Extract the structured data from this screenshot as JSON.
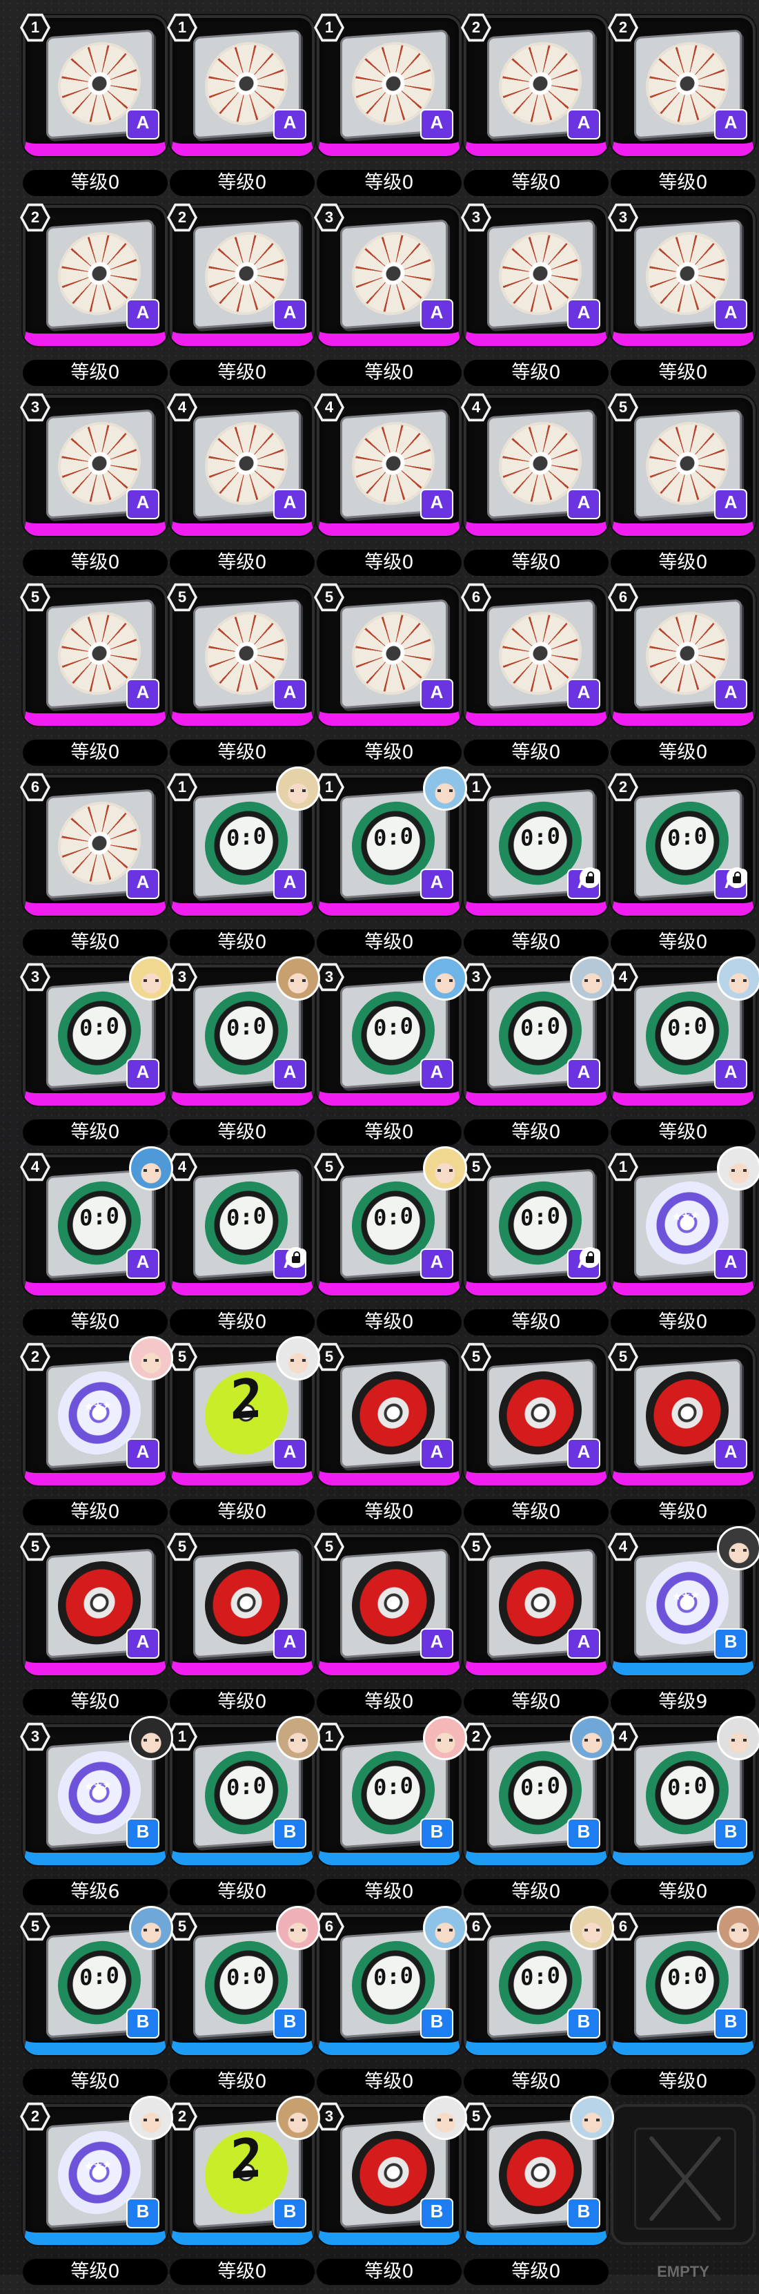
{
  "colors": {
    "rarity_a": "#f01ef0",
    "rarity_b": "#1e9cf5",
    "background": "#1c1c1e"
  },
  "empty_label": "EMPTY",
  "items": [
    {
      "slot": "1",
      "disc": "flower",
      "rarity": "A",
      "level": "等级0"
    },
    {
      "slot": "1",
      "disc": "flower",
      "rarity": "A",
      "level": "等级0"
    },
    {
      "slot": "1",
      "disc": "flower",
      "rarity": "A",
      "level": "等级0"
    },
    {
      "slot": "2",
      "disc": "flower",
      "rarity": "A",
      "level": "等级0"
    },
    {
      "slot": "2",
      "disc": "flower",
      "rarity": "A",
      "level": "等级0"
    },
    {
      "slot": "2",
      "disc": "flower",
      "rarity": "A",
      "level": "等级0"
    },
    {
      "slot": "2",
      "disc": "flower",
      "rarity": "A",
      "level": "等级0"
    },
    {
      "slot": "3",
      "disc": "flower",
      "rarity": "A",
      "level": "等级0"
    },
    {
      "slot": "3",
      "disc": "flower",
      "rarity": "A",
      "level": "等级0"
    },
    {
      "slot": "3",
      "disc": "flower",
      "rarity": "A",
      "level": "等级0"
    },
    {
      "slot": "3",
      "disc": "flower",
      "rarity": "A",
      "level": "等级0"
    },
    {
      "slot": "4",
      "disc": "flower",
      "rarity": "A",
      "level": "等级0"
    },
    {
      "slot": "4",
      "disc": "flower",
      "rarity": "A",
      "level": "等级0"
    },
    {
      "slot": "4",
      "disc": "flower",
      "rarity": "A",
      "level": "等级0"
    },
    {
      "slot": "5",
      "disc": "flower",
      "rarity": "A",
      "level": "等级0"
    },
    {
      "slot": "5",
      "disc": "flower",
      "rarity": "A",
      "level": "等级0"
    },
    {
      "slot": "5",
      "disc": "flower",
      "rarity": "A",
      "level": "等级0"
    },
    {
      "slot": "5",
      "disc": "flower",
      "rarity": "A",
      "level": "等级0"
    },
    {
      "slot": "6",
      "disc": "flower",
      "rarity": "A",
      "level": "等级0"
    },
    {
      "slot": "6",
      "disc": "flower",
      "rarity": "A",
      "level": "等级0"
    },
    {
      "slot": "6",
      "disc": "flower",
      "rarity": "A",
      "level": "等级0"
    },
    {
      "slot": "1",
      "disc": "clock",
      "rarity": "A",
      "level": "等级0",
      "portrait": "#e6d2a8"
    },
    {
      "slot": "1",
      "disc": "clock",
      "rarity": "A",
      "level": "等级0",
      "portrait": "#8ec3e8"
    },
    {
      "slot": "1",
      "disc": "clock",
      "rarity": "A",
      "level": "等级0",
      "locked": true
    },
    {
      "slot": "2",
      "disc": "clock",
      "rarity": "A",
      "level": "等级0",
      "locked": true
    },
    {
      "slot": "3",
      "disc": "clock",
      "rarity": "A",
      "level": "等级0",
      "portrait": "#f0d890"
    },
    {
      "slot": "3",
      "disc": "clock",
      "rarity": "A",
      "level": "等级0",
      "portrait": "#c8a070"
    },
    {
      "slot": "3",
      "disc": "clock",
      "rarity": "A",
      "level": "等级0",
      "portrait": "#6fb4e6"
    },
    {
      "slot": "3",
      "disc": "clock",
      "rarity": "A",
      "level": "等级0",
      "portrait": "#b4c8d8"
    },
    {
      "slot": "4",
      "disc": "clock",
      "rarity": "A",
      "level": "等级0",
      "portrait": "#b8d4e8"
    },
    {
      "slot": "4",
      "disc": "clock",
      "rarity": "A",
      "level": "等级0",
      "portrait": "#4e9ad8"
    },
    {
      "slot": "4",
      "disc": "clock",
      "rarity": "A",
      "level": "等级0",
      "locked": true
    },
    {
      "slot": "5",
      "disc": "clock",
      "rarity": "A",
      "level": "等级0",
      "portrait": "#f0d890"
    },
    {
      "slot": "5",
      "disc": "clock",
      "rarity": "A",
      "level": "等级0",
      "locked": true
    },
    {
      "slot": "1",
      "disc": "stars",
      "rarity": "A",
      "level": "等级0",
      "portrait": "#e8e8e8"
    },
    {
      "slot": "2",
      "disc": "stars",
      "rarity": "A",
      "level": "等级0",
      "portrait": "#f4c8c8"
    },
    {
      "slot": "5",
      "disc": "two",
      "rarity": "A",
      "level": "等级0",
      "portrait": "#e8e8e8"
    },
    {
      "slot": "5",
      "disc": "red",
      "rarity": "A",
      "level": "等级0"
    },
    {
      "slot": "5",
      "disc": "red",
      "rarity": "A",
      "level": "等级0"
    },
    {
      "slot": "5",
      "disc": "red",
      "rarity": "A",
      "level": "等级0"
    },
    {
      "slot": "5",
      "disc": "red",
      "rarity": "A",
      "level": "等级0"
    },
    {
      "slot": "5",
      "disc": "red",
      "rarity": "A",
      "level": "等级0"
    },
    {
      "slot": "5",
      "disc": "red",
      "rarity": "A",
      "level": "等级0"
    },
    {
      "slot": "5",
      "disc": "red",
      "rarity": "A",
      "level": "等级0"
    },
    {
      "slot": "4",
      "disc": "stars",
      "rarity": "B",
      "level": "等级9",
      "portrait": "#3a3a3a"
    },
    {
      "slot": "3",
      "disc": "stars",
      "rarity": "B",
      "level": "等级6",
      "portrait": "#2a2a2a"
    },
    {
      "slot": "1",
      "disc": "clock",
      "rarity": "B",
      "level": "等级0",
      "portrait": "#c8a880"
    },
    {
      "slot": "1",
      "disc": "clock",
      "rarity": "B",
      "level": "等级0",
      "portrait": "#f4b8b8"
    },
    {
      "slot": "2",
      "disc": "clock",
      "rarity": "B",
      "level": "等级0",
      "portrait": "#6fa8d8"
    },
    {
      "slot": "4",
      "disc": "clock",
      "rarity": "B",
      "level": "等级0",
      "portrait": "#e0e0e0"
    },
    {
      "slot": "5",
      "disc": "clock",
      "rarity": "B",
      "level": "等级0",
      "portrait": "#6fa8d8"
    },
    {
      "slot": "5",
      "disc": "clock",
      "rarity": "B",
      "level": "等级0",
      "portrait": "#f0b0b8"
    },
    {
      "slot": "6",
      "disc": "clock",
      "rarity": "B",
      "level": "等级0",
      "portrait": "#8ec3e8"
    },
    {
      "slot": "6",
      "disc": "clock",
      "rarity": "B",
      "level": "等级0",
      "portrait": "#e6d2a8"
    },
    {
      "slot": "6",
      "disc": "clock",
      "rarity": "B",
      "level": "等级0",
      "portrait": "#c89878"
    },
    {
      "slot": "2",
      "disc": "stars",
      "rarity": "B",
      "level": "等级0",
      "portrait": "#e8e8e8"
    },
    {
      "slot": "2",
      "disc": "two",
      "rarity": "B",
      "level": "等级0",
      "portrait": "#c8a070"
    },
    {
      "slot": "3",
      "disc": "red",
      "rarity": "B",
      "level": "等级0",
      "portrait": "#e8e8e8"
    },
    {
      "slot": "5",
      "disc": "red",
      "rarity": "B",
      "level": "等级0",
      "portrait": "#b8d4e8"
    },
    {
      "empty": true
    }
  ],
  "disc_glyphs": {
    "clock": "0:0",
    "two": "2",
    "stars": "★★★",
    "flower": "",
    "red": ""
  }
}
